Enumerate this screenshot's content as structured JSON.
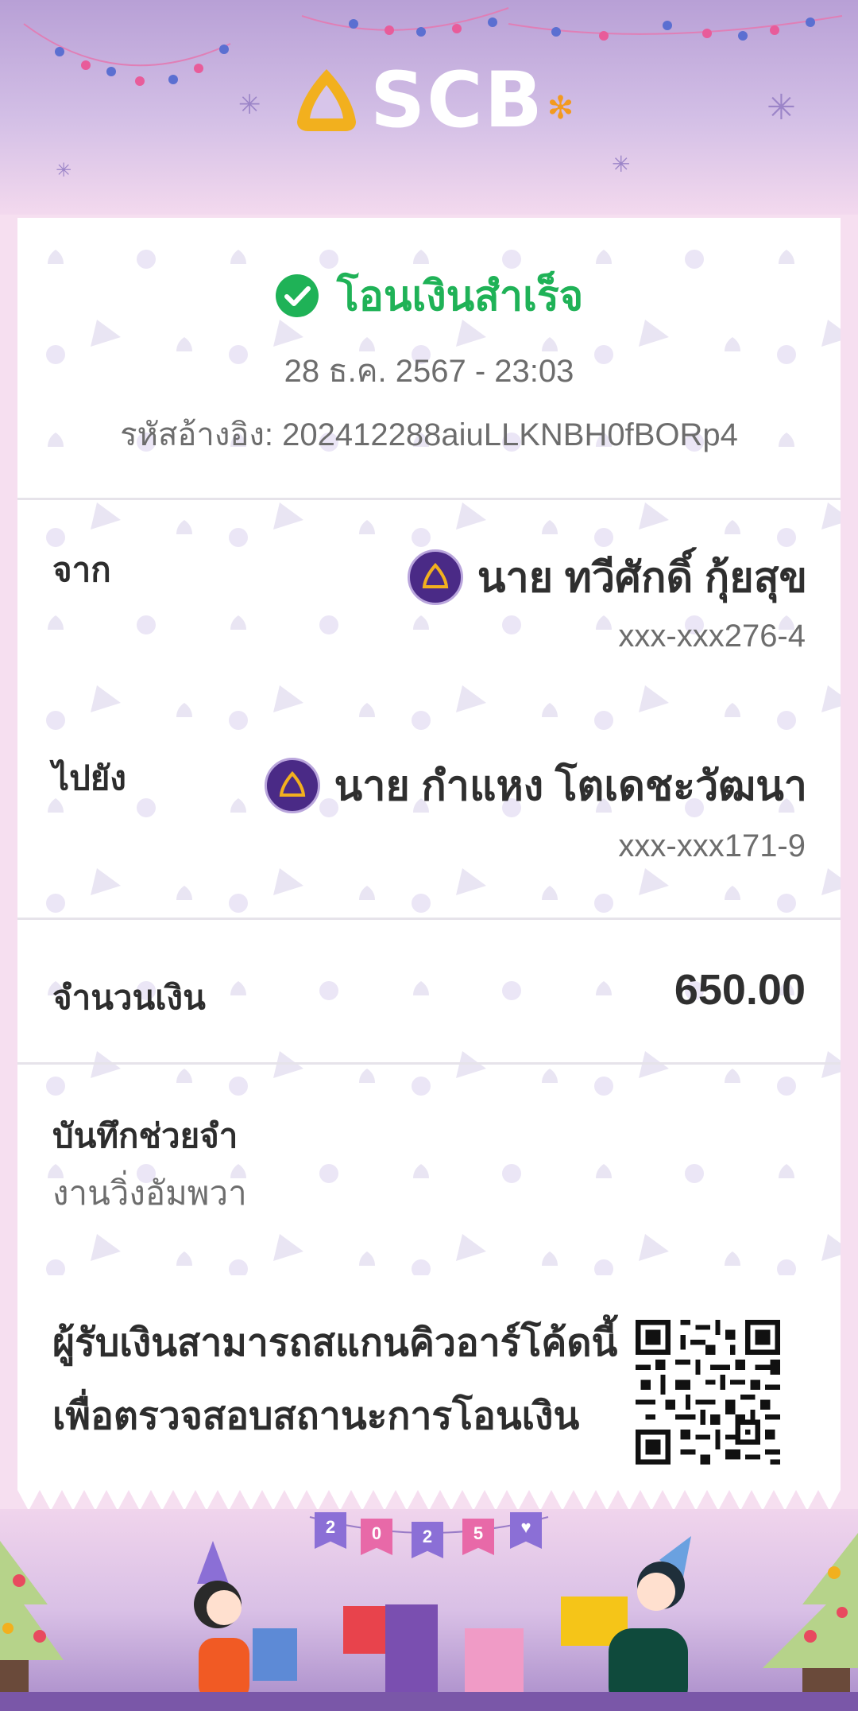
{
  "brand": {
    "name": "SCB",
    "primary_color": "#4a2a86",
    "gold": "#f2b01e",
    "success_color": "#1fb257"
  },
  "header": {
    "logo_icon": "scb-bell-logo-icon",
    "logo_text": "SCB"
  },
  "status": {
    "icon": "check-circle-icon",
    "title": "โอนเงินสำเร็จ"
  },
  "transaction": {
    "datetime": "28 ธ.ค. 2567 - 23:03",
    "reference": "รหัสอ้างอิง: 202412288aiuLLKNBH0fBORp4"
  },
  "from": {
    "label": "จาก",
    "name": "นาย ทวีศักดิ์ กุ้ยสุข",
    "account": "xxx-xxx276-4",
    "bank_icon": "scb-bank-icon"
  },
  "to": {
    "label": "ไปยัง",
    "name": "นาย กำแหง โตเดชะวัฒนา",
    "account": "xxx-xxx171-9",
    "bank_icon": "scb-bank-icon"
  },
  "amount": {
    "label": "จำนวนเงิน",
    "value": "650.00"
  },
  "memo": {
    "label": "บันทึกช่วยจำ",
    "value": "งานวิ่งอัมพวา"
  },
  "qr": {
    "line1": "ผู้รับเงินสามารถสแกนคิวอาร์โค้ดนี้",
    "line2": "เพื่อตรวจสอบสถานะการโอนเงิน",
    "icon": "qr-code-icon"
  },
  "footer": {
    "banner": [
      "2",
      "0",
      "2",
      "5",
      "♥"
    ]
  }
}
